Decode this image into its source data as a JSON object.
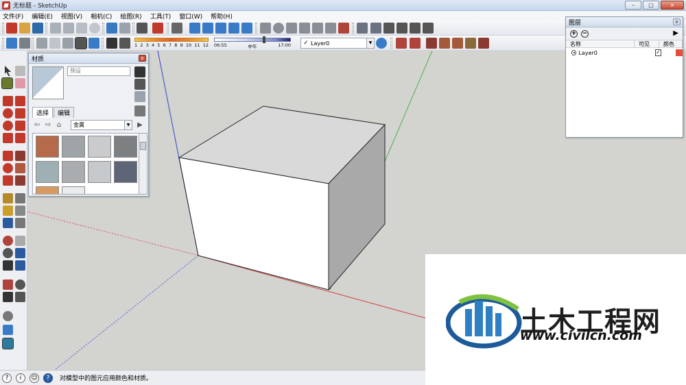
{
  "window": {
    "title": "无标题 - SketchUp",
    "controls": {
      "minimize": "–",
      "maximize": "□",
      "close": "×"
    }
  },
  "menu": [
    "文件(F)",
    "编辑(E)",
    "视图(V)",
    "相机(C)",
    "绘图(R)",
    "工具(T)",
    "窗口(W)",
    "帮助(H)"
  ],
  "toolbar": {
    "shadow_months": [
      "1",
      "2",
      "3",
      "4",
      "5",
      "6",
      "7",
      "8",
      "9",
      "10",
      "11",
      "12"
    ],
    "shadow_times": [
      "06:55",
      "中午",
      "17:00"
    ],
    "current_layer": "Layer0",
    "current_layer_check": "✓",
    "dropdown_arrow": "▼"
  },
  "materials_panel": {
    "title": "材质",
    "close": "x",
    "material_name_placeholder": "预设",
    "tabs": [
      "选择",
      "编辑"
    ],
    "nav": {
      "back": "⇦",
      "forward": "⇨",
      "home": "⌂",
      "details": "▶"
    },
    "collection": "金属",
    "swatch_colors": [
      "#b56a4a",
      "#9ea4a8",
      "#c9cbcd",
      "#7d8082",
      "#9fb0b5",
      "#a9adaf",
      "#c6c9cc",
      "#5d6576",
      "#d79a62",
      "#e9ebec"
    ]
  },
  "layers_panel": {
    "title": "图层",
    "close": "x",
    "add": "+",
    "remove": "−",
    "details": "▶",
    "columns": {
      "name": "名称",
      "visible": "可见",
      "color": "颜色"
    },
    "layers": [
      {
        "name": "Layer0",
        "visible": true,
        "visible_mark": "✓",
        "color": "#e74c3c"
      }
    ]
  },
  "status": {
    "icons": [
      "?",
      "i",
      "☺",
      "?"
    ],
    "text": "对模型中的图元应用颜色和材质。"
  },
  "watermark": {
    "title": "土木工程网",
    "url": "www.civilcn.com",
    "logo_colors": [
      "#2e7fc4",
      "#7fc241",
      "#1d5a9a"
    ]
  },
  "colors": {
    "axis_red": "#d23c3c",
    "axis_green": "#4caf50",
    "axis_blue": "#3344cc",
    "viewport_bg": "#d3d3d0"
  }
}
